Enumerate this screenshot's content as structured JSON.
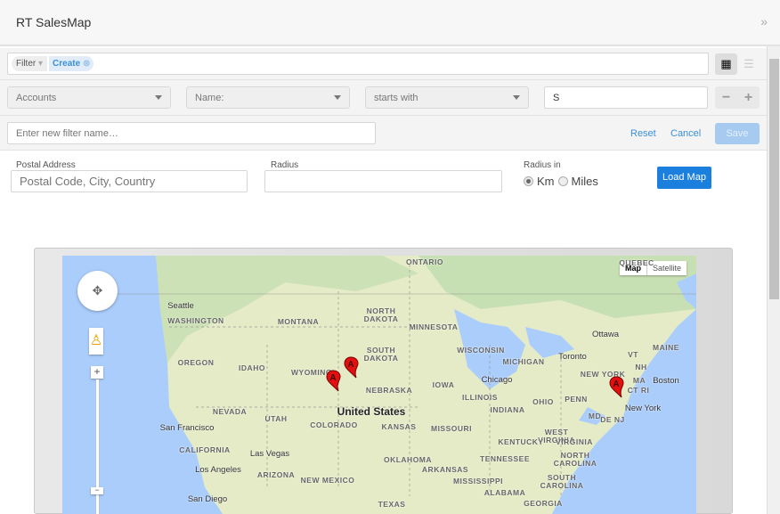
{
  "header": {
    "title": "RT SalesMap",
    "collapse_icon": "double-chevron-right-icon"
  },
  "filterbar": {
    "filter_label": "Filter",
    "chip": "Create",
    "view_icons": [
      "grid-icon",
      "list-icon"
    ]
  },
  "criteria": {
    "module": "Accounts",
    "field": "Name:",
    "operator": "starts with",
    "value": "S",
    "remove": "−",
    "add": "+"
  },
  "save_row": {
    "placeholder": "Enter new filter name…",
    "reset": "Reset",
    "cancel": "Cancel",
    "save": "Save"
  },
  "form": {
    "postal_label": "Postal Address",
    "postal_placeholder": "Postal Code, City, Country",
    "radius_label": "Radius",
    "radius_value": "",
    "unit_label": "Radius in",
    "units": [
      "Km",
      "Miles"
    ],
    "selected_unit": "Km",
    "load": "Load Map"
  },
  "map": {
    "type_buttons": [
      "Map",
      "Satellite"
    ],
    "selected_type": "Map",
    "marker_letter": "A",
    "regions": [
      "WASHINGTON",
      "MONTANA",
      "NORTH\nDAKOTA",
      "SOUTH\nDAKOTA",
      "OREGON",
      "IDAHO",
      "WYOMING",
      "NEBRASKA",
      "NEVADA",
      "UTAH",
      "COLORADO",
      "KANSAS",
      "CALIFORNIA",
      "ARIZONA",
      "NEW MEXICO",
      "OKLAHOMA",
      "TEXAS",
      "ONTARIO",
      "QUEBEC",
      "MINNESOTA",
      "WISCONSIN",
      "MICHIGAN",
      "MAINE",
      "VT",
      "NH",
      "NEW YORK",
      "MA",
      "IOWA",
      "CT RI",
      "ILLINOIS",
      "OHIO",
      "PENN",
      "INDIANA",
      "MD",
      "DE NJ",
      "MISSOURI",
      "WEST\nVIRGINIA",
      "KENTUCKY",
      "VIRGINIA",
      "NORTH\nCAROLINA",
      "TENNESSEE",
      "ARKANSAS",
      "SOUTH\nCAROLINA",
      "MISSISSIPPI",
      "ALABAMA",
      "GEORGIA"
    ],
    "cities": [
      "Seattle",
      "San Francisco",
      "Las Vegas",
      "Los Angeles",
      "San Diego",
      "Toronto",
      "Ottawa",
      "Boston",
      "Chicago",
      "New York"
    ],
    "country": "United States"
  }
}
